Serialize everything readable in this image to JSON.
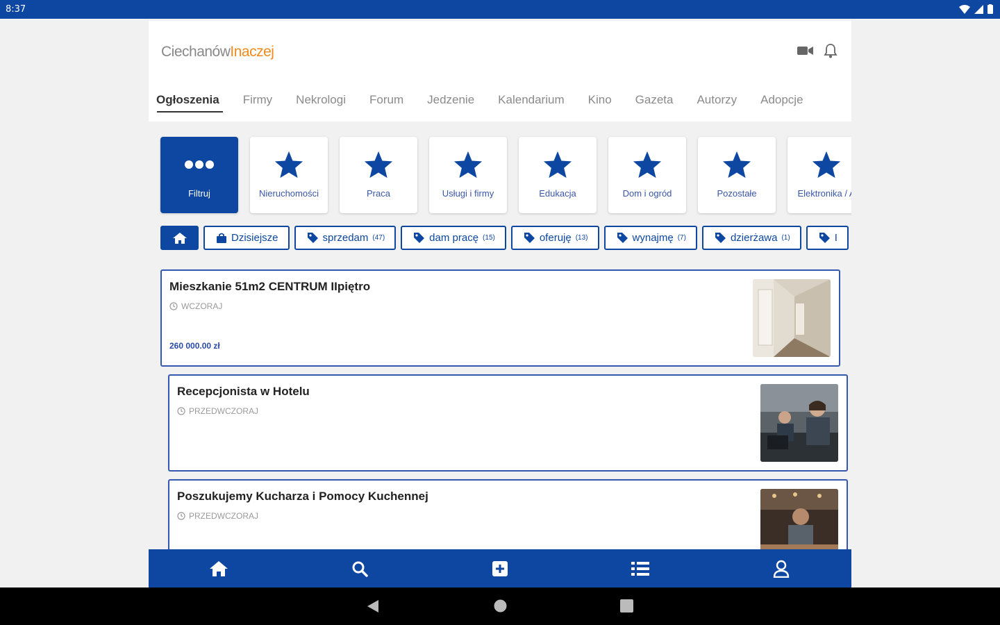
{
  "status_bar": {
    "time": "8:37"
  },
  "brand": {
    "logo_part1": "Ciechanów",
    "logo_part2": "Inaczej"
  },
  "tabs": [
    {
      "label": "Ogłoszenia",
      "active": true
    },
    {
      "label": "Firmy"
    },
    {
      "label": "Nekrologi"
    },
    {
      "label": "Forum"
    },
    {
      "label": "Jedzenie"
    },
    {
      "label": "Kalendarium"
    },
    {
      "label": "Kino"
    },
    {
      "label": "Gazeta"
    },
    {
      "label": "Autorzy"
    },
    {
      "label": "Adopcje"
    }
  ],
  "categories": [
    {
      "label": "Filtruj",
      "icon": "more-dots-icon",
      "active": true
    },
    {
      "label": "Nieruchomości",
      "icon": "star-icon"
    },
    {
      "label": "Praca",
      "icon": "star-icon"
    },
    {
      "label": "Usługi i firmy",
      "icon": "star-icon"
    },
    {
      "label": "Edukacja",
      "icon": "star-icon"
    },
    {
      "label": "Dom i ogród",
      "icon": "star-icon"
    },
    {
      "label": "Pozostałe",
      "icon": "star-icon"
    },
    {
      "label": "Elektronika / A",
      "icon": "star-icon"
    }
  ],
  "chips": [
    {
      "label": "Dzisiejsze",
      "count": "",
      "icon": "bag-icon"
    },
    {
      "label": "sprzedam",
      "count": "(47)",
      "icon": "tag-icon"
    },
    {
      "label": "dam pracę",
      "count": "(15)",
      "icon": "tag-icon"
    },
    {
      "label": "oferuję",
      "count": "(13)",
      "icon": "tag-icon"
    },
    {
      "label": "wynajmę",
      "count": "(7)",
      "icon": "tag-icon"
    },
    {
      "label": "dzierżawa",
      "count": "(1)",
      "icon": "tag-icon"
    },
    {
      "label": "I",
      "count": "",
      "icon": "tag-icon"
    }
  ],
  "listings": [
    {
      "title": "Mieszkanie 51m2 CENTRUM IIpiętro",
      "date": "WCZORAJ",
      "price": "260 000.00 zł"
    },
    {
      "title": "Recepcjonista w Hotelu",
      "date": "PRZEDWCZORAJ",
      "price": ""
    },
    {
      "title": "Poszukujemy Kucharza i Pomocy Kuchennej",
      "date": "PRZEDWCZORAJ",
      "price": ""
    }
  ],
  "bottom_nav": [
    {
      "name": "home-icon"
    },
    {
      "name": "search-icon"
    },
    {
      "name": "add-icon"
    },
    {
      "name": "list-icon"
    },
    {
      "name": "user-icon"
    }
  ],
  "colors": {
    "primary": "#0d47a1",
    "accent": "#f08a1c"
  }
}
